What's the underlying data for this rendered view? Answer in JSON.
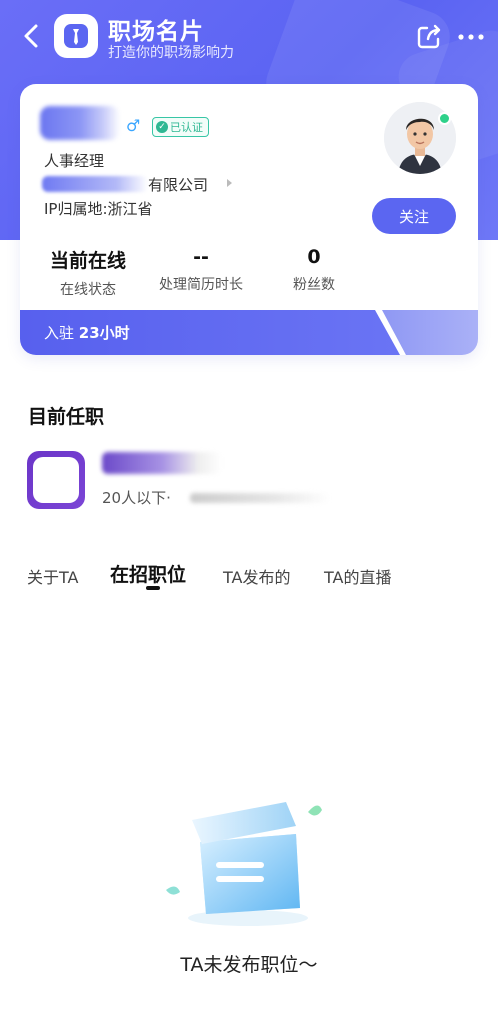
{
  "header": {
    "title": "职场名片",
    "subtitle": "打造你的职场影响力"
  },
  "profile": {
    "verified_label": "已认证",
    "job_title": "人事经理",
    "company_suffix": "有限公司",
    "ip_location": "IP归属地:浙江省",
    "follow_label": "关注"
  },
  "stats": [
    {
      "value": "当前在线",
      "label": "在线状态"
    },
    {
      "value": "--",
      "label": "处理简历时长"
    },
    {
      "value": "0",
      "label": "粉丝数"
    }
  ],
  "join": {
    "prefix": "入驻",
    "duration": "23小时"
  },
  "current_job": {
    "section_title": "目前任职",
    "company_size": "20人以下·"
  },
  "tabs": [
    {
      "label": "关于TA"
    },
    {
      "label": "在招职位"
    },
    {
      "label": "TA发布的"
    },
    {
      "label": "TA的直播"
    }
  ],
  "empty_state": {
    "message": "TA未发布职位～"
  },
  "colors": {
    "primary": "#5b66f1",
    "verified": "#2fb893",
    "online": "#2ed18a"
  }
}
